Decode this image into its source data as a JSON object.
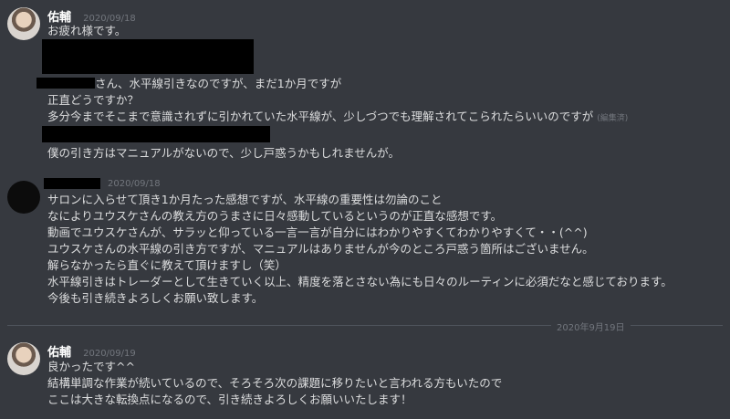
{
  "messages": [
    {
      "username": "佑輔",
      "timestamp": "2020/09/18",
      "lines": [
        "お疲れ様です。",
        "さん、水平線引きなのですが、まだ1か月ですが",
        "正直どうですか？",
        "多分今までそこまで意識されずに引かれていた水平線が、少しづつでも理解されてこられたらいいのですが",
        "僕の引き方はマニュアルがないので、少し戸惑うかもしれませんが。"
      ],
      "edited_label": "(編集済)"
    },
    {
      "username": "",
      "timestamp": "2020/09/18",
      "lines": [
        "サロンに入らせて頂き1か月たった感想ですが、水平線の重要性は勿論のこと",
        "なによりユウスケさんの教え方のうまさに日々感動しているというのが正直な感想です。",
        "動画でユウスケさんが、サラッと仰っている一言一言が自分にはわかりやすくてわかりやすくて・・(^^)",
        "ユウスケさんの水平線の引き方ですが、マニュアルはありませんが今のところ戸惑う箇所はございません。",
        "解らなかったら直ぐに教えて頂けますし（笑）",
        "水平線引きはトレーダーとして生きていく以上、精度を落とさない為にも日々のルーティンに必須だなと感じております。",
        "今後も引き続きよろしくお願い致します。"
      ]
    },
    {
      "username": "佑輔",
      "timestamp": "2020/09/19",
      "lines": [
        "良かったです^^",
        "結構単調な作業が続いているので、そろそろ次の課題に移りたいと言われる方もいたので",
        "ここは大きな転換点になるので、引き続きよろしくお願いいたします！"
      ]
    }
  ],
  "date_divider": "2020年9月19日"
}
